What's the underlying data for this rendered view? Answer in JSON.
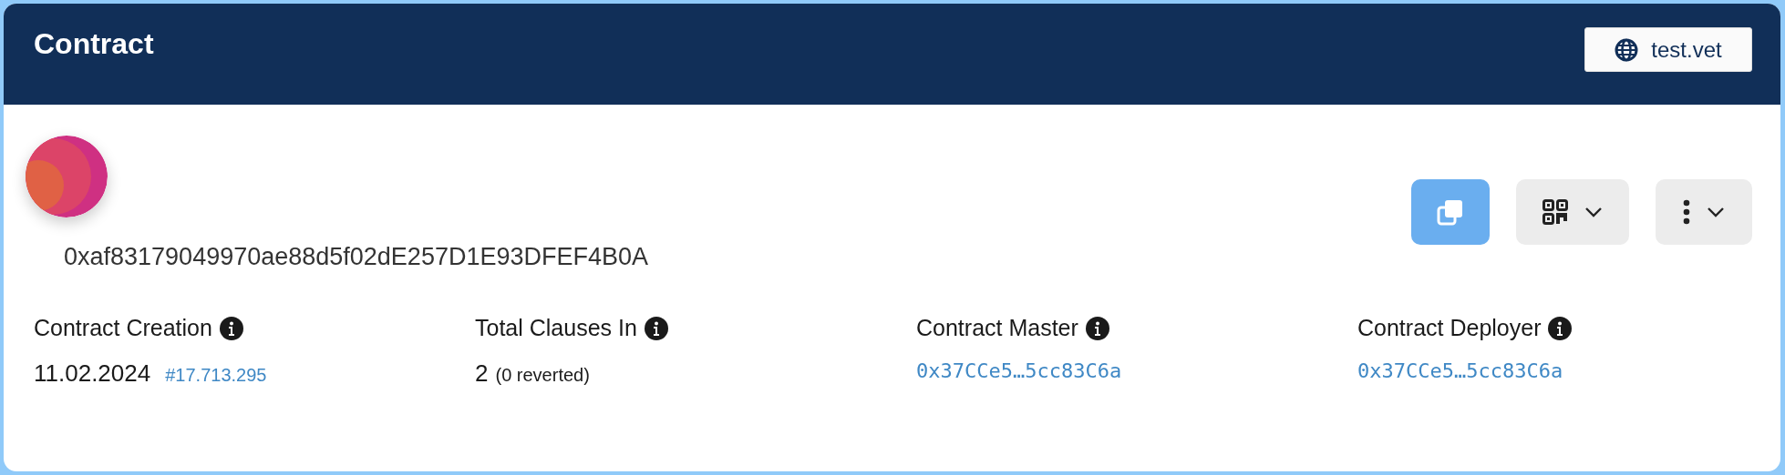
{
  "header": {
    "title": "Contract",
    "network_button": "test.vet"
  },
  "address": "0xaf83179049970ae88d5f02dE257D1E93DFEF4B0A",
  "actions": [
    {
      "kind": "copy"
    },
    {
      "kind": "qr"
    },
    {
      "kind": "more"
    }
  ],
  "stats": [
    {
      "label": "Contract Creation",
      "kind": "date-block",
      "value": "11.02.2024",
      "link": "#17.713.295"
    },
    {
      "label": "Total Clauses In",
      "kind": "count",
      "value": "2",
      "note": "(0 reverted)"
    },
    {
      "label": "Contract Master",
      "kind": "address",
      "link": "0x37CCe5…5cc83C6a"
    },
    {
      "label": "Contract Deployer",
      "kind": "address",
      "link": "0x37CCe5…5cc83C6a"
    }
  ]
}
